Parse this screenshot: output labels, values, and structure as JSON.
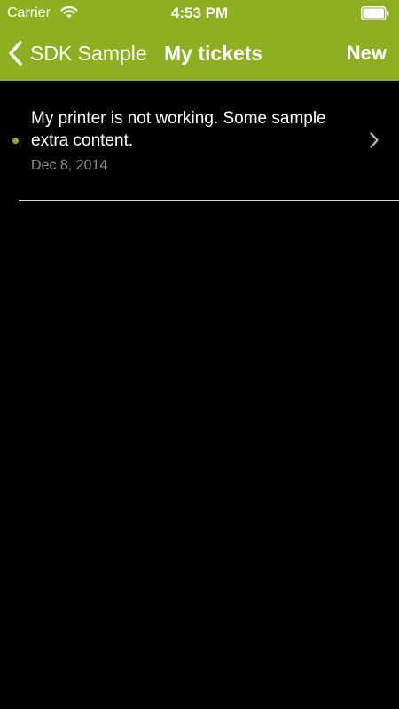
{
  "status_bar": {
    "carrier": "Carrier",
    "time": "4:53 PM",
    "wifi_icon": "wifi-icon",
    "battery_icon": "battery-icon"
  },
  "nav": {
    "back_label": "SDK Sample",
    "title": "My tickets",
    "new_label": "New"
  },
  "tickets": [
    {
      "subject": "My printer is not working.  Some sample extra content.",
      "date": "Dec 8, 2014",
      "unread": true
    }
  ],
  "colors": {
    "accent": "#8eb020",
    "background": "#000000",
    "unread_dot": "#8eb020"
  }
}
